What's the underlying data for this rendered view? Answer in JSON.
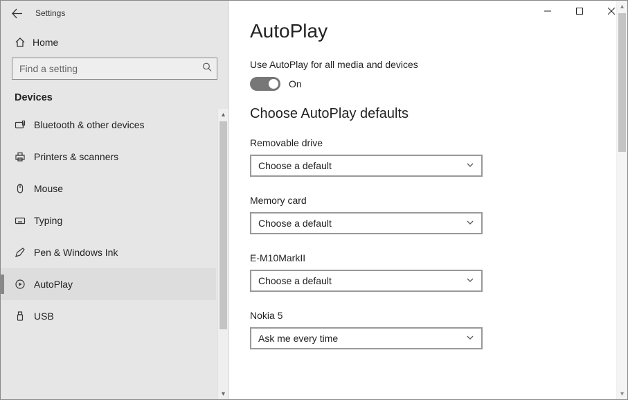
{
  "window": {
    "title": "Settings"
  },
  "sidebar": {
    "home_label": "Home",
    "search_placeholder": "Find a setting",
    "section_label": "Devices",
    "items": [
      {
        "label": "Bluetooth & other devices"
      },
      {
        "label": "Printers & scanners"
      },
      {
        "label": "Mouse"
      },
      {
        "label": "Typing"
      },
      {
        "label": "Pen & Windows Ink"
      },
      {
        "label": "AutoPlay"
      },
      {
        "label": "USB"
      }
    ]
  },
  "main": {
    "title": "AutoPlay",
    "toggle_description": "Use AutoPlay for all media and devices",
    "toggle_state": "On",
    "subheader": "Choose AutoPlay defaults",
    "fields": [
      {
        "label": "Removable drive",
        "value": "Choose a default"
      },
      {
        "label": "Memory card",
        "value": "Choose a default"
      },
      {
        "label": "E-M10MarkII",
        "value": "Choose a default"
      },
      {
        "label": "Nokia 5",
        "value": "Ask me every time"
      }
    ]
  }
}
